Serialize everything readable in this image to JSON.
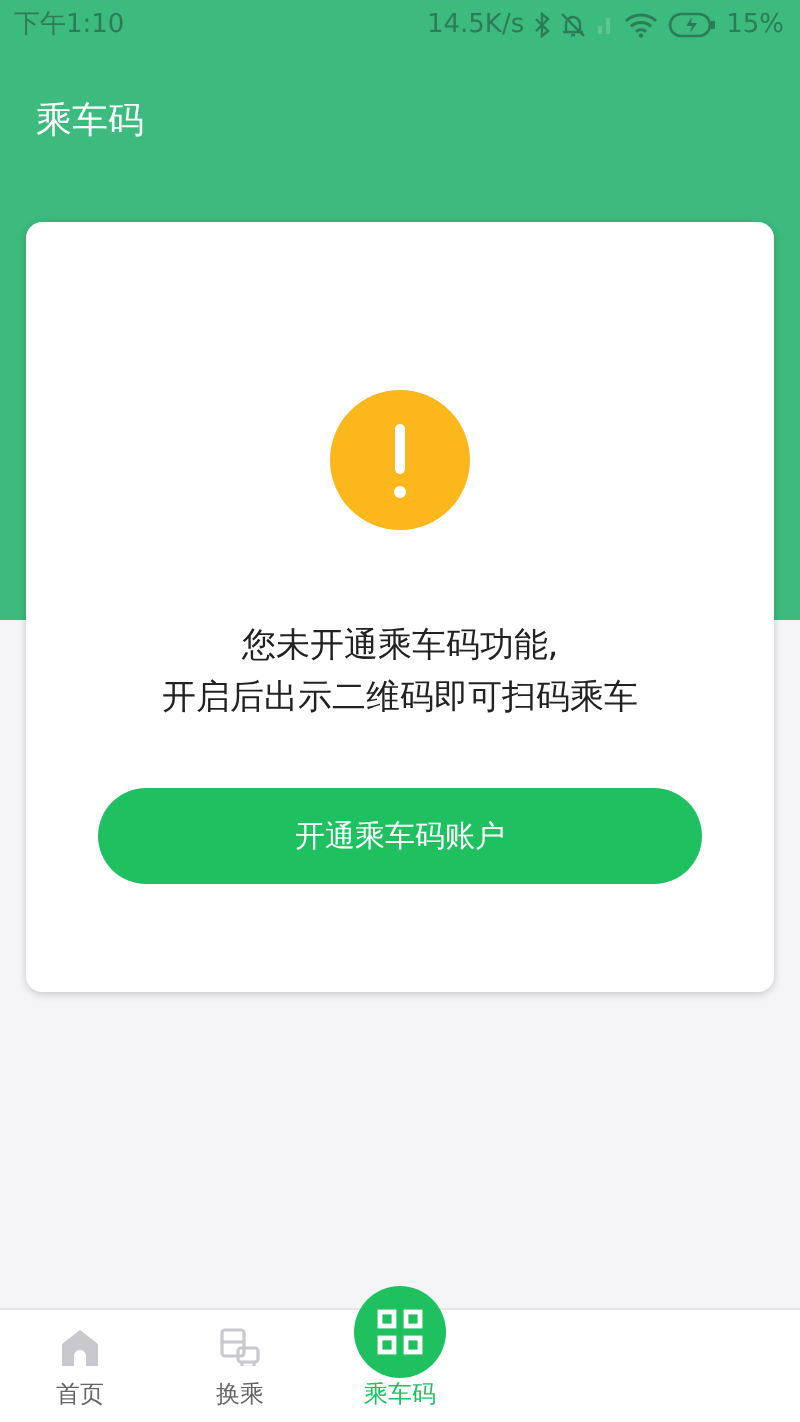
{
  "status_bar": {
    "time": "下午1:10",
    "speed": "14.5K/s",
    "battery": "15%"
  },
  "header": {
    "title": "乘车码"
  },
  "notice": {
    "message": "您未开通乘车码功能,\n开启后出示二维码即可扫码乘车"
  },
  "button": {
    "label": "开通乘车码账户"
  },
  "nav": [
    {
      "label": "首页",
      "kind": "home",
      "selected": false
    },
    {
      "label": "换乘",
      "kind": "transfer",
      "selected": false
    },
    {
      "label": "乘车码",
      "kind": "qr",
      "selected": true
    }
  ]
}
